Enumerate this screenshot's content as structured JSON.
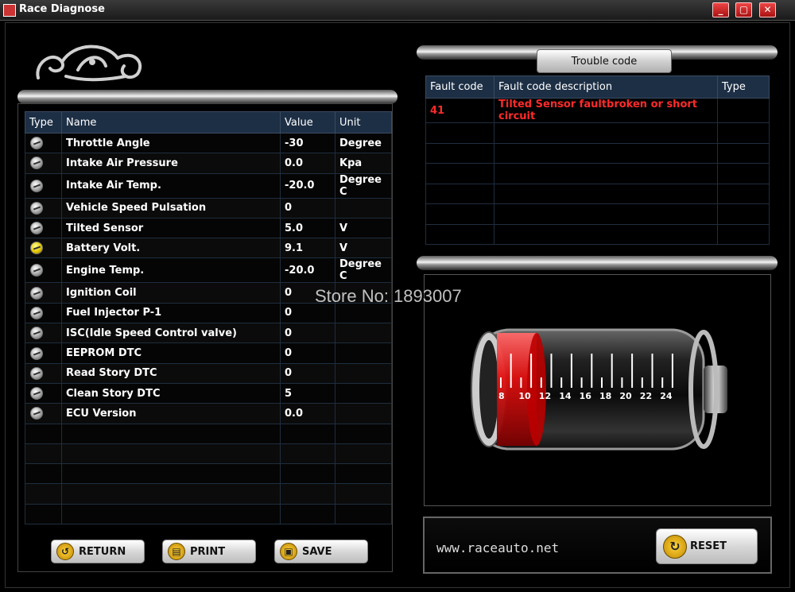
{
  "window": {
    "title": "Race Diagnose",
    "min_label": "_",
    "max_label": "▢",
    "close_label": "✕"
  },
  "params": {
    "headers": {
      "type": "Type",
      "name": "Name",
      "value": "Value",
      "unit": "Unit"
    },
    "rows": [
      {
        "name": "Throttle Angle",
        "value": "-30",
        "unit": "Degree",
        "icon": "gauge-icon"
      },
      {
        "name": "Intake Air Pressure",
        "value": "0.0",
        "unit": "Kpa",
        "icon": "gauge-icon"
      },
      {
        "name": "Intake Air Temp.",
        "value": "-20.0",
        "unit": "Degree C",
        "icon": "gauge-icon"
      },
      {
        "name": "Vehicle Speed Pulsation",
        "value": "0",
        "unit": "",
        "icon": "gauge-icon"
      },
      {
        "name": "Tilted Sensor",
        "value": "5.0",
        "unit": "V",
        "icon": "gauge-icon"
      },
      {
        "name": "Battery Volt.",
        "value": "9.1",
        "unit": "V",
        "icon": "gauge-icon-yellow"
      },
      {
        "name": "Engine Temp.",
        "value": "-20.0",
        "unit": "Degree C",
        "icon": "gauge-icon"
      },
      {
        "name": "Ignition Coil",
        "value": "0",
        "unit": "",
        "icon": "gauge-icon"
      },
      {
        "name": "Fuel Injector P-1",
        "value": "0",
        "unit": "",
        "icon": "gauge-icon"
      },
      {
        "name": "ISC(Idle Speed Control valve)",
        "value": "0",
        "unit": "",
        "icon": "gauge-icon"
      },
      {
        "name": "EEPROM DTC",
        "value": "0",
        "unit": "",
        "icon": "gauge-icon"
      },
      {
        "name": "Read Story DTC",
        "value": "0",
        "unit": "",
        "icon": "gauge-icon"
      },
      {
        "name": "Clean Story DTC",
        "value": "5",
        "unit": "",
        "icon": "gauge-icon"
      },
      {
        "name": "ECU Version",
        "value": "0.0",
        "unit": "",
        "icon": "gauge-icon"
      }
    ],
    "empty_rows": 5
  },
  "buttons": {
    "return": "RETURN",
    "print": "PRINT",
    "save": "SAVE",
    "reset": "RESET"
  },
  "trouble": {
    "tab_label": "Trouble code",
    "headers": {
      "code": "Fault code",
      "desc": "Fault code description",
      "type": "Type"
    },
    "rows": [
      {
        "code": "41",
        "desc": "Tilted Sensor faultbroken or short circuit",
        "type": ""
      }
    ],
    "empty_rows": 6
  },
  "battery": {
    "scale": [
      "8",
      "10",
      "12",
      "14",
      "16",
      "18",
      "20",
      "22",
      "24"
    ],
    "fill_color": "#e01010"
  },
  "footer": {
    "website": "www.raceauto.net"
  },
  "watermark": "Store No: 1893007"
}
